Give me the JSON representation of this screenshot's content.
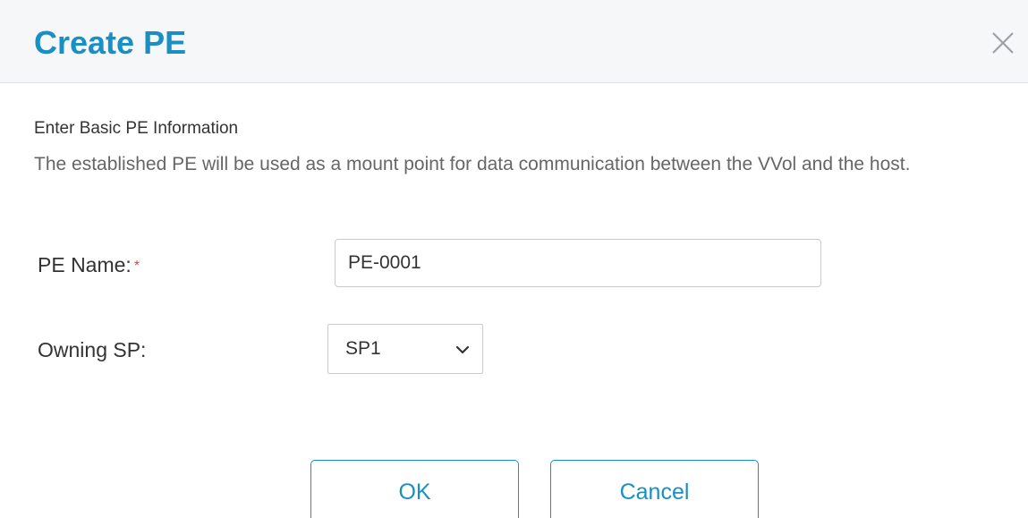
{
  "dialog": {
    "title": "Create PE",
    "close_icon": "close-icon"
  },
  "section": {
    "title": "Enter Basic PE Information",
    "description": "The established PE will be used as a mount point for data communication between the VVol and the host."
  },
  "form": {
    "pe_name": {
      "label": "PE Name:",
      "required_marker": "*",
      "value": "PE-0001"
    },
    "owning_sp": {
      "label": "Owning SP:",
      "selected": "SP1",
      "chevron_icon": "chevron-down-icon"
    }
  },
  "actions": {
    "ok_label": "OK",
    "cancel_label": "Cancel"
  },
  "colors": {
    "accent": "#1a8fc4",
    "required": "#e0443e",
    "header_bg": "#f5f7f8"
  }
}
